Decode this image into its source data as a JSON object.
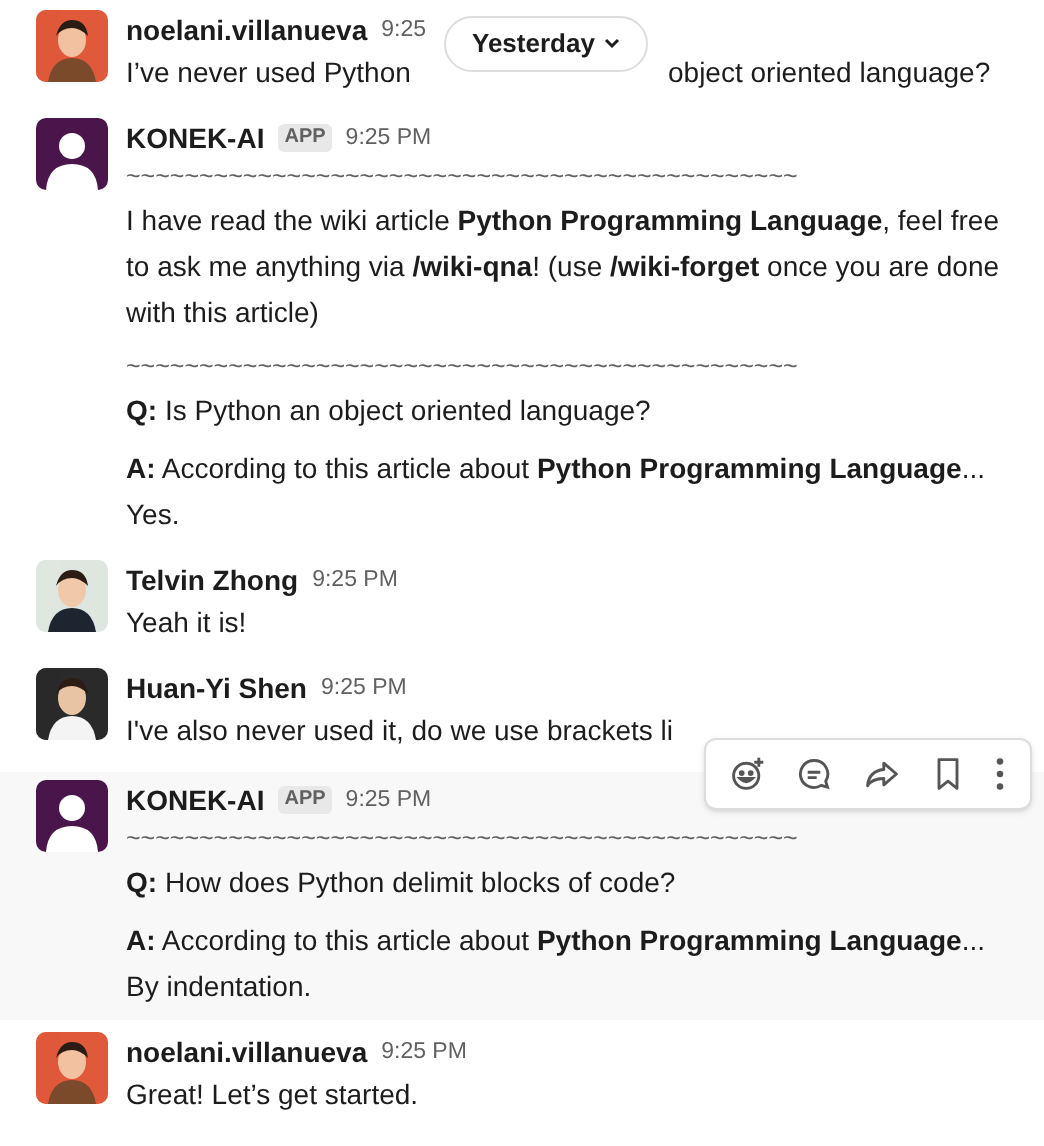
{
  "date_divider": {
    "label": "Yesterday"
  },
  "messages": [
    {
      "author": "noelani.villanueva",
      "time": "9:25",
      "kind": "person",
      "hovered": false,
      "lines": [
        {
          "kind": "split",
          "parts": [
            "I’ve never used Python",
            "object oriented language?"
          ]
        }
      ]
    },
    {
      "author": "KONEK-AI",
      "badge": "APP",
      "time": "9:25 PM",
      "kind": "bot",
      "hovered": false,
      "lines": [
        {
          "kind": "rule",
          "text": "~~~~~~~~~~~~~~~~~~~~~~~~~~~~~~~~~~~~~~~~~~~~~~"
        },
        {
          "kind": "text",
          "text": "I have read the wiki article **Python Programming Language**, feel free to ask me anything via **/wiki-qna**! (use **/wiki-forget** once you are done with this article)"
        },
        {
          "kind": "rule",
          "text": "~~~~~~~~~~~~~~~~~~~~~~~~~~~~~~~~~~~~~~~~~~~~~~"
        },
        {
          "kind": "text",
          "text": "**Q:** Is Python an object oriented language?"
        },
        {
          "kind": "text",
          "text": "**A:** According to this article about **Python Programming Language**...\nYes."
        }
      ]
    },
    {
      "author": "Telvin Zhong",
      "time": "9:25 PM",
      "kind": "person",
      "hovered": false,
      "lines": [
        {
          "kind": "text",
          "text": "Yeah it is!"
        }
      ]
    },
    {
      "author": "Huan-Yi Shen",
      "time": "9:25 PM",
      "kind": "person",
      "hovered": false,
      "lines": [
        {
          "kind": "text",
          "text": "I've also never used it, do we use brackets li"
        }
      ]
    },
    {
      "author": "KONEK-AI",
      "badge": "APP",
      "time": "9:25 PM",
      "kind": "bot",
      "hovered": true,
      "lines": [
        {
          "kind": "rule",
          "text": "~~~~~~~~~~~~~~~~~~~~~~~~~~~~~~~~~~~~~~~~~~~~~~"
        },
        {
          "kind": "text",
          "text": "**Q:** How does Python delimit blocks of code?"
        },
        {
          "kind": "text",
          "text": "**A:** According to this article about **Python Programming Language**...\nBy indentation."
        }
      ]
    },
    {
      "author": "noelani.villanueva",
      "time": "9:25 PM",
      "kind": "person",
      "hovered": false,
      "lines": [
        {
          "kind": "text",
          "text": "Great! Let’s get started."
        }
      ]
    }
  ]
}
